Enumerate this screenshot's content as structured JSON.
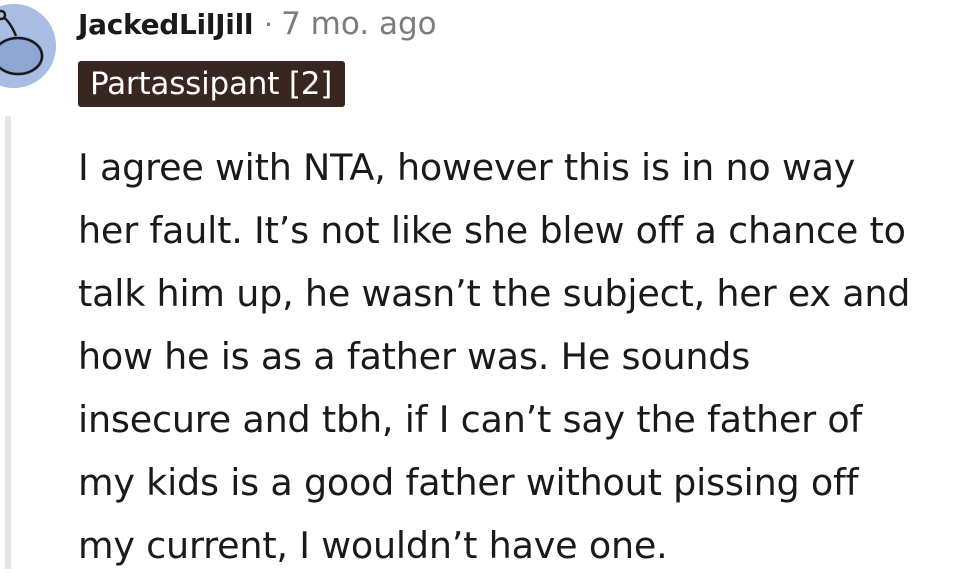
{
  "comment": {
    "author": "JackedLilJill",
    "separator": "·",
    "timestamp": "7 mo. ago",
    "flair": "Partassipant [2]",
    "avatar_icon": "snoo-avatar-icon",
    "avatar_color": "#a9bde2",
    "flair_background": "#3a2621",
    "body": "I agree with NTA, however this is in no way\nher fault. It’s not like she blew off a chance to\ntalk him up, he wasn’t the subject, her ex and\nhow he is as a father was. He sounds\ninsecure and tbh, if I can’t say the father of\nmy kids is a good father without pissing off\nmy current, I wouldn’t have one."
  }
}
